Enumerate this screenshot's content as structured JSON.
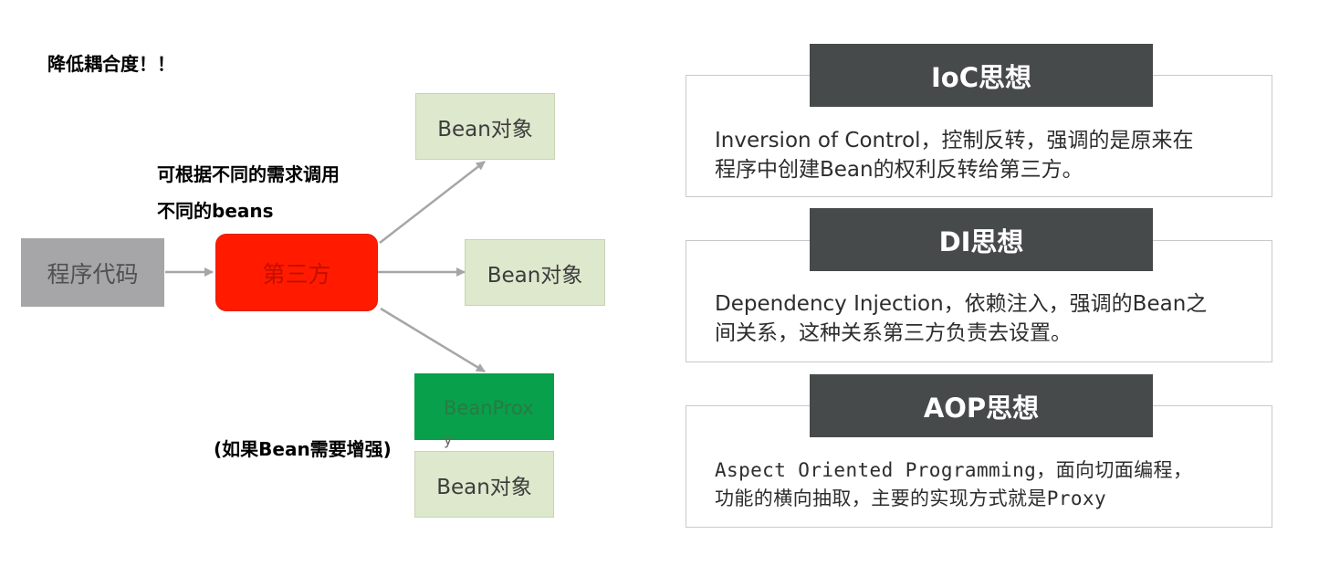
{
  "diagram": {
    "heading": "降低耦合度！！",
    "annotation_line1": "可根据不同的需求调用",
    "annotation_line2": "不同的beans",
    "proxy_note": "(如果Bean需要增强)",
    "program_node": "程序代码",
    "third_party_node": "第三方",
    "bean_nodes": [
      "Bean对象",
      "Bean对象",
      "Bean对象"
    ],
    "proxy_node_text": "BeanProx",
    "proxy_node_wrap": "y",
    "colors": {
      "program_fill": "#a6a6a8",
      "third_party_fill": "#ff1a00",
      "bean_fill": "#dde8cc",
      "proxy_fill": "#08a04a",
      "arrow": "#a6a6a6"
    }
  },
  "concepts": [
    {
      "title": "IoC思想",
      "line1": "Inversion of Control，控制反转，强调的是原来在",
      "line2": "程序中创建Bean的权利反转给第三方。"
    },
    {
      "title": "DI思想",
      "line1": "Dependency Injection，依赖注入，强调的Bean之",
      "line2": "间关系，这种关系第三方负责去设置。"
    },
    {
      "title": "AOP思想",
      "line1": "Aspect Oriented Programming，面向切面编程，",
      "line2": "功能的横向抽取，主要的实现方式就是Proxy"
    }
  ],
  "panel_colors": {
    "title_fill": "#474a4b",
    "title_text": "#ffffff",
    "border": "#c9c9c9"
  }
}
